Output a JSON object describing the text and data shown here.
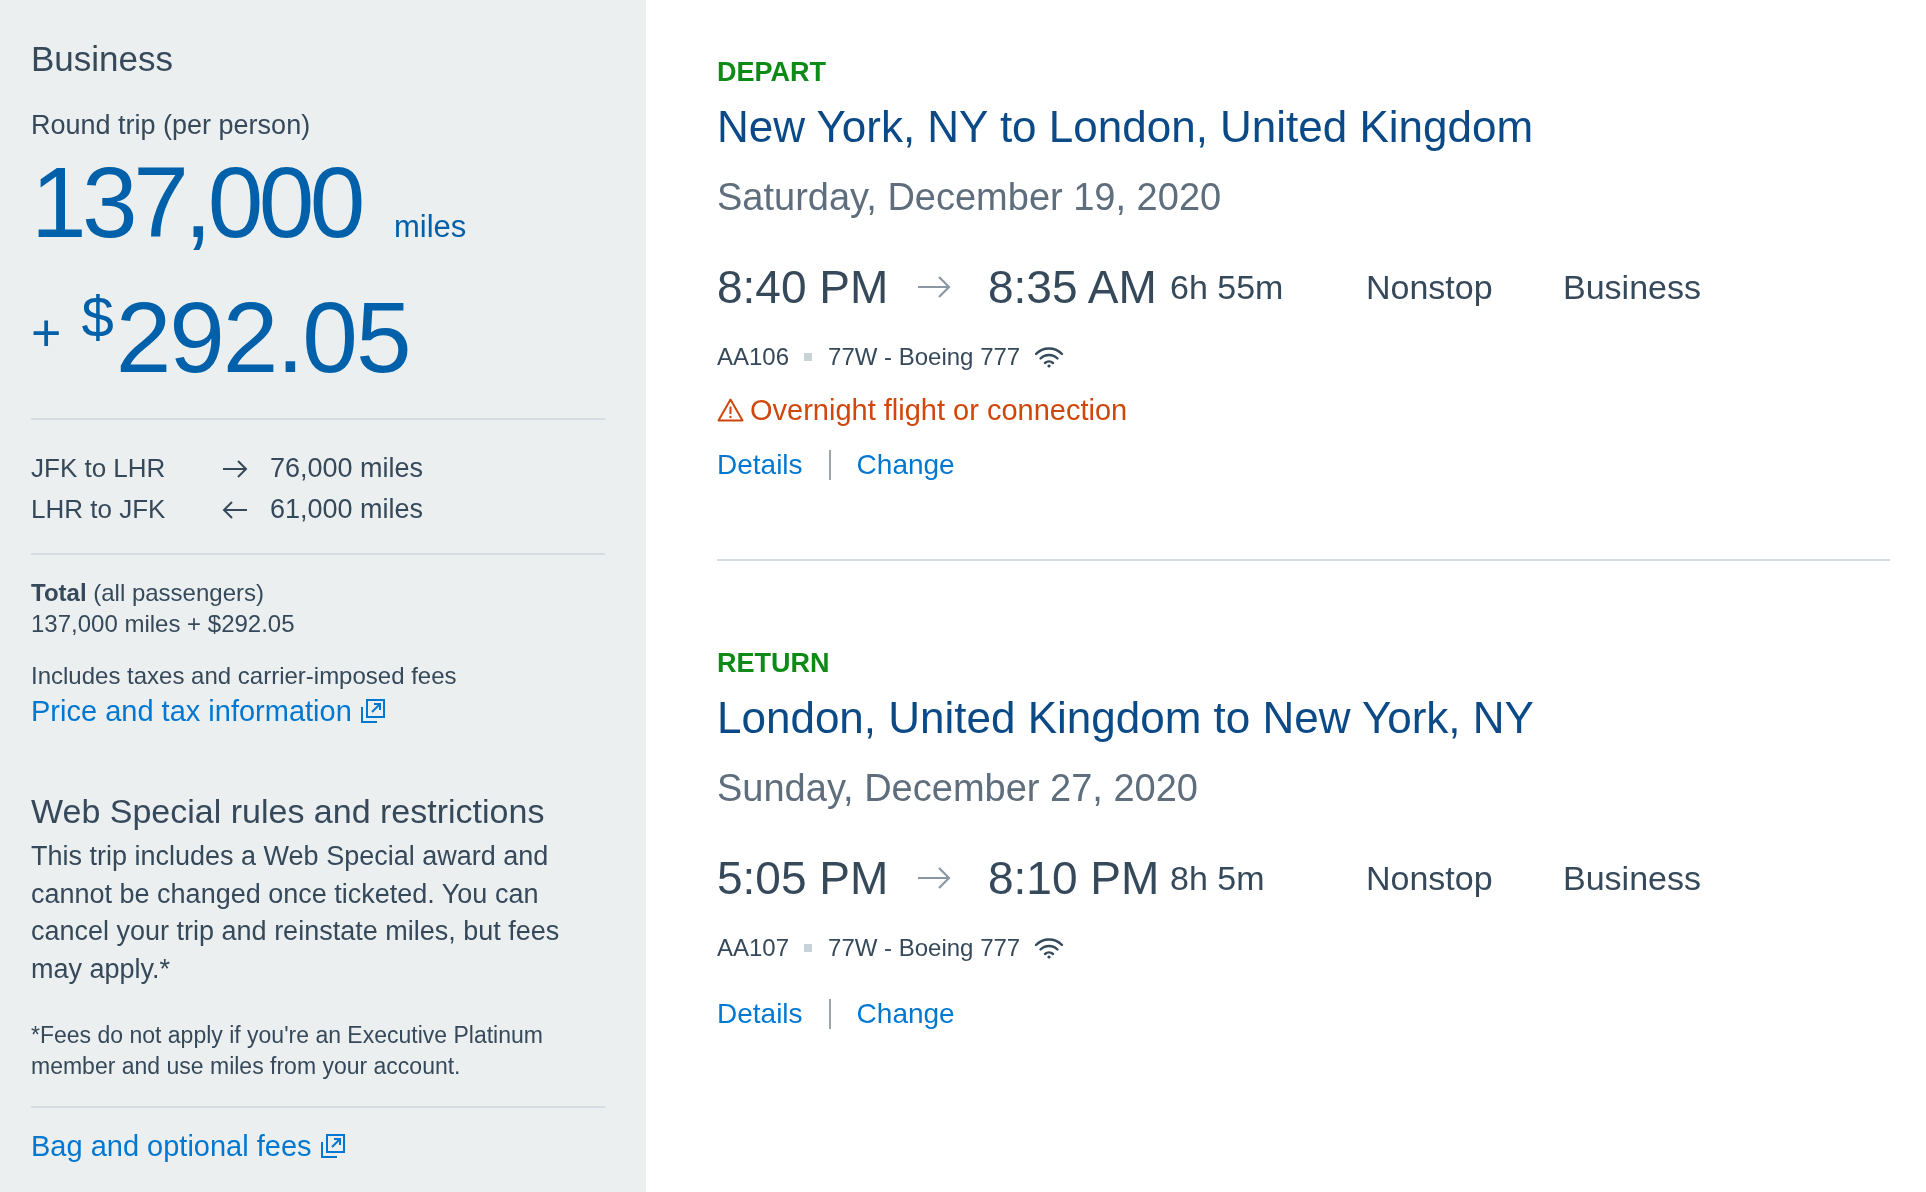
{
  "fare_summary": {
    "cabin": "Business",
    "trip_type": "Round trip (per person)",
    "miles": "137,000",
    "miles_unit": "miles",
    "plus": "+",
    "currency": "$",
    "cash": "292.05",
    "legs": [
      {
        "kind": "outbound",
        "route": "JFK to LHR",
        "miles": "76,000 miles"
      },
      {
        "kind": "inbound",
        "route": "LHR to JFK",
        "miles": "61,000 miles"
      }
    ],
    "total_label": "**Total** (all passengers)",
    "total": "137,000 miles + $292.05",
    "fees_note": "Includes taxes and carrier-imposed fees",
    "price_link": "Price and tax information"
  },
  "rules": {
    "heading": "Web Special rules and restrictions",
    "body": "This trip includes a Web Special award and cannot be changed once ticketed. You can cancel your trip and reinstate miles, but fees may apply.*",
    "footnote": "*Fees do not apply if you're an Executive Platinum member and use miles from your account."
  },
  "bag_link": "Bag and optional fees",
  "flights": [
    {
      "label": "DEPART",
      "route": "New York, NY to London, United Kingdom",
      "date": "Saturday, December 19, 2020",
      "depart_time": "8:40 PM",
      "arrive_time": "8:35 AM",
      "duration": "6h 55m",
      "stops": "Nonstop",
      "cabin": "Business",
      "flight_number": "AA106",
      "aircraft": "77W - Boeing 777",
      "warning": "Overnight flight or connection",
      "links": [
        "Details",
        "Change"
      ]
    },
    {
      "label": "RETURN",
      "route": "London, United Kingdom to New York, NY",
      "date": "Sunday, December 27, 2020",
      "depart_time": "5:05 PM",
      "arrive_time": "8:10 PM",
      "duration": "8h 5m",
      "stops": "Nonstop",
      "cabin": "Business",
      "flight_number": "AA107",
      "aircraft": "77W - Boeing 777",
      "links": [
        "Details",
        "Change"
      ]
    }
  ]
}
